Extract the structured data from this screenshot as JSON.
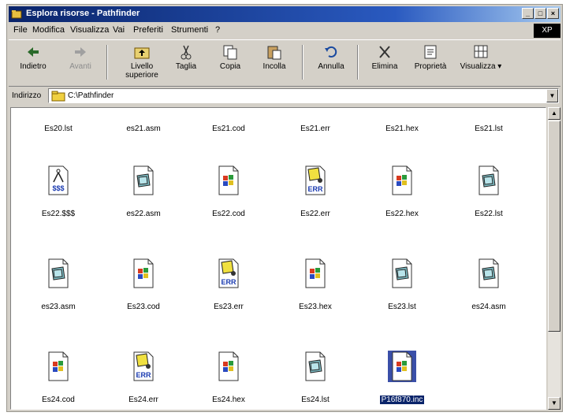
{
  "window": {
    "title": "Esplora risorse - Pathfinder",
    "flag_text": "XP"
  },
  "menu": [
    "File",
    "Modifica",
    "Visualizza",
    "Vai",
    "Preferiti",
    "Strumenti",
    "?"
  ],
  "toolbar": {
    "back": "Indietro",
    "forward": "Avanti",
    "up": [
      "Livello",
      "superiore"
    ],
    "cut": "Taglia",
    "copy": "Copia",
    "paste": "Incolla",
    "undo": "Annulla",
    "delete": "Elimina",
    "properties": "Proprietà",
    "views": "Visualizza"
  },
  "address": {
    "label": "Indirizzo",
    "value": "C:\\Pathfinder"
  },
  "files": [
    {
      "name": "Es20.lst",
      "icon": "partial"
    },
    {
      "name": "es21.asm",
      "icon": "partial"
    },
    {
      "name": "Es21.cod",
      "icon": "partial"
    },
    {
      "name": "Es21.err",
      "icon": "partial"
    },
    {
      "name": "Es21.hex",
      "icon": "partial"
    },
    {
      "name": "Es21.lst",
      "icon": "partial"
    },
    {
      "name": "Es22.$$$",
      "icon": "dollar-file-icon"
    },
    {
      "name": "es22.asm",
      "icon": "generic-file-icon"
    },
    {
      "name": "Es22.cod",
      "icon": "windows-file-icon"
    },
    {
      "name": "Es22.err",
      "icon": "err-file-icon"
    },
    {
      "name": "Es22.hex",
      "icon": "windows-file-icon"
    },
    {
      "name": "Es22.lst",
      "icon": "generic-file-icon"
    },
    {
      "name": "es23.asm",
      "icon": "generic-file-icon"
    },
    {
      "name": "Es23.cod",
      "icon": "windows-file-icon"
    },
    {
      "name": "Es23.err",
      "icon": "err-file-icon"
    },
    {
      "name": "Es23.hex",
      "icon": "windows-file-icon"
    },
    {
      "name": "Es23.lst",
      "icon": "generic-file-icon"
    },
    {
      "name": "es24.asm",
      "icon": "generic-file-icon"
    },
    {
      "name": "Es24.cod",
      "icon": "windows-file-icon"
    },
    {
      "name": "Es24.err",
      "icon": "err-file-icon"
    },
    {
      "name": "Es24.hex",
      "icon": "windows-file-icon"
    },
    {
      "name": "Es24.lst",
      "icon": "generic-file-icon"
    },
    {
      "name": "P16f870.inc",
      "icon": "windows-file-icon",
      "selected": true
    }
  ],
  "icon_labels": {
    "err": "ERR",
    "dollar": "$$$"
  },
  "colors": {
    "title_start": "#0a246a",
    "title_end": "#a6caf0",
    "selection": "#0a246a"
  }
}
